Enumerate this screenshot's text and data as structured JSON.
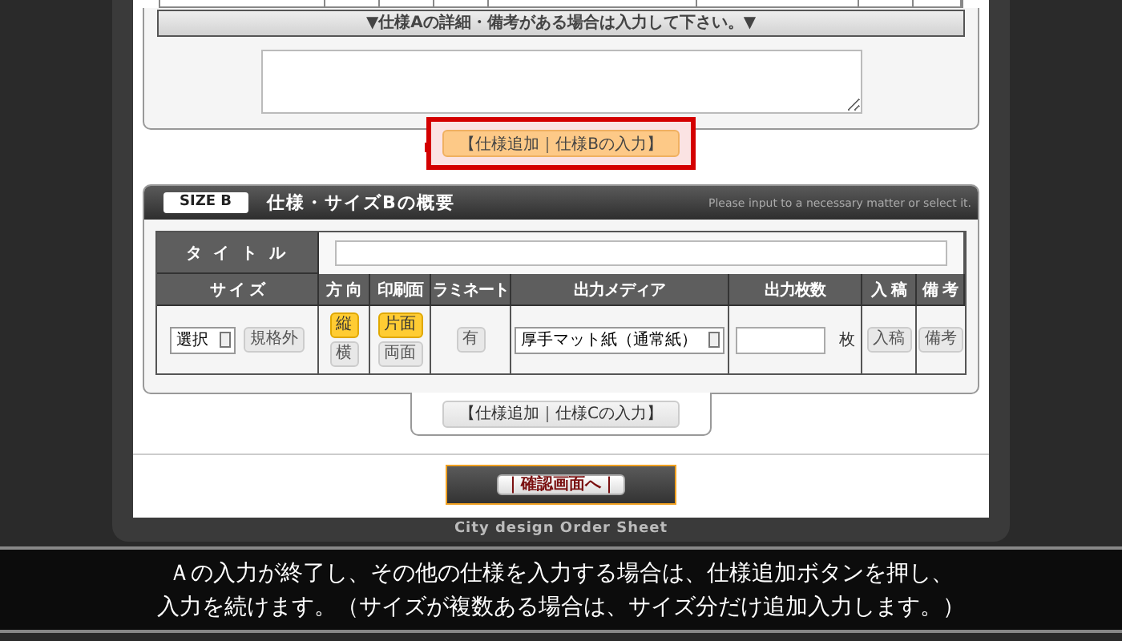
{
  "section_a": {
    "notice": "▼仕様Aの詳細・備考がある場合は入力して下さい。▼",
    "add_button": {
      "label": "【仕様追加｜仕様Bの入力】",
      "highlighted": true
    }
  },
  "section_b": {
    "badge": "SIZE B",
    "title": "仕様・サイズBの概要",
    "hint": "Please input to a necessary matter or select it.",
    "title_label": "タ イ ト ル",
    "columns": [
      "サ イ ズ",
      "方 向",
      "印刷面",
      "ラミネート",
      "出力メディア",
      "出力枚数",
      "入 稿",
      "備 考"
    ],
    "size_select": "選択",
    "size_custom": "規格外",
    "orientation": [
      {
        "label": "縦",
        "selected": true
      },
      {
        "label": "横",
        "selected": false
      }
    ],
    "print_side": [
      {
        "label": "片面",
        "selected": true
      },
      {
        "label": "両面",
        "selected": false
      }
    ],
    "lamination": {
      "label": "有",
      "selected": false
    },
    "media_select": "厚手マット紙（通常紙）",
    "quantity_unit": "枚",
    "manuscript_button": "入稿",
    "remarks_button": "備考",
    "add_button": {
      "label": "【仕様追加｜仕様Cの入力】",
      "highlighted": false
    }
  },
  "confirm_button": "｜確認画面へ｜",
  "footer": "City design Order Sheet",
  "caption_lines": [
    "Ａの入力が終了し、その他の仕様を入力する場合は、仕様追加ボタンを押し、",
    "入力を続けます。（サイズが複数ある場合は、サイズ分だけ追加入力します。）"
  ]
}
